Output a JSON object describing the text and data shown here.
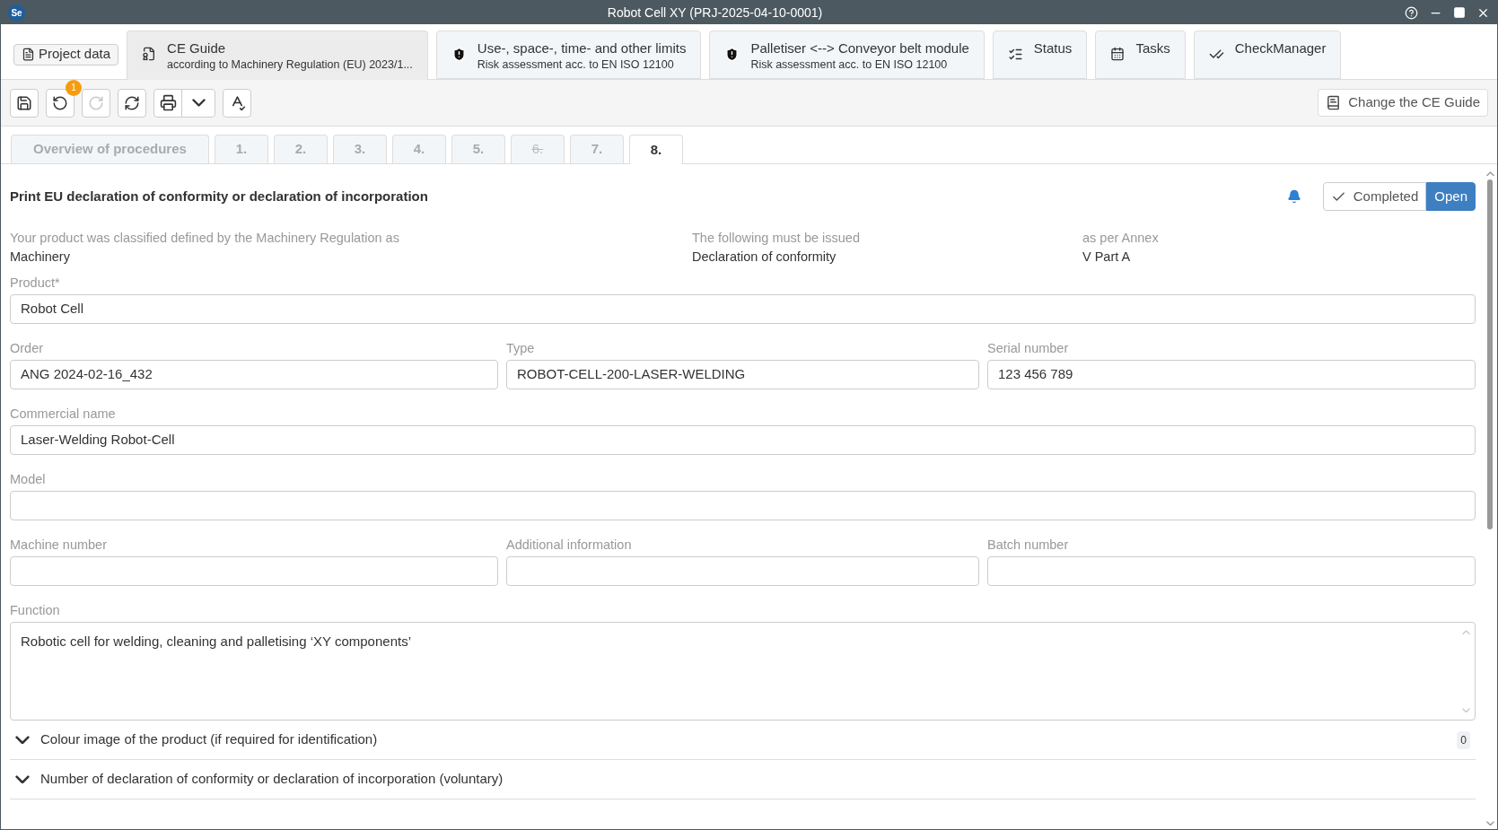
{
  "window": {
    "logo": "Se",
    "title": "Robot Cell XY (PRJ-2025-04-10-0001)"
  },
  "doc_tabs": [
    {
      "kind": "project",
      "title": "Project data"
    },
    {
      "kind": "guide",
      "title": "CE Guide",
      "subtitle": "according to Machinery Regulation (EU) 2023/1...",
      "selected": true
    },
    {
      "kind": "risk",
      "title": "Use-, space-, time- and other limits",
      "subtitle": "Risk assessment acc. to EN ISO 12100",
      "selected": false
    },
    {
      "kind": "risk",
      "title": "Palletiser <--> Conveyor belt module",
      "subtitle": "Risk assessment acc. to EN ISO 12100",
      "selected": false
    },
    {
      "kind": "status",
      "title": "Status",
      "selected": false
    },
    {
      "kind": "tasks",
      "title": "Tasks",
      "selected": false
    },
    {
      "kind": "check",
      "title": "CheckManager",
      "selected": false
    }
  ],
  "toolbar": [
    {
      "kind": "save",
      "disabled": false
    },
    {
      "kind": "undo",
      "disabled": false,
      "badge": "1"
    },
    {
      "kind": "redo",
      "disabled": true
    },
    {
      "kind": "refresh",
      "disabled": false
    },
    {
      "kind": "print",
      "disabled": false
    },
    {
      "kind": "spellcheck",
      "disabled": false
    }
  ],
  "change_guide_button": "Change the CE Guide",
  "steps": [
    {
      "label": "Overview of procedures",
      "selected": false,
      "disabled": false
    },
    {
      "label": "1.",
      "selected": false,
      "disabled": false
    },
    {
      "label": "2.",
      "selected": false,
      "disabled": false
    },
    {
      "label": "3.",
      "selected": false,
      "disabled": false
    },
    {
      "label": "4.",
      "selected": false,
      "disabled": false
    },
    {
      "label": "5.",
      "selected": false,
      "disabled": false
    },
    {
      "label": "6.",
      "selected": false,
      "disabled": true
    },
    {
      "label": "7.",
      "selected": false,
      "disabled": false
    },
    {
      "label": "8.",
      "selected": true,
      "disabled": false
    }
  ],
  "heading": "Print EU declaration of conformity or declaration of incorporation",
  "status_toggle": [
    {
      "label": "Completed",
      "selected": false
    },
    {
      "label": "Open",
      "selected": true
    }
  ],
  "info": [
    {
      "label": "Your product was classified defined by the Machinery Regulation as",
      "value": "Machinery"
    },
    {
      "label": "The following must be issued",
      "value": "Declaration of conformity"
    },
    {
      "label": "as per Annex",
      "value": "V Part A"
    }
  ],
  "field_rows": [
    [
      {
        "label": "Product*",
        "value": "Robot Cell"
      }
    ],
    [
      {
        "label": "Order",
        "value": "ANG 2024-02-16_432"
      },
      {
        "label": "Type",
        "value": "ROBOT-CELL-200-LASER-WELDING"
      },
      {
        "label": "Serial number",
        "value": "123 456 789"
      }
    ],
    [
      {
        "label": "Commercial name",
        "value": "Laser-Welding Robot-Cell"
      }
    ],
    [
      {
        "label": "Model"
      }
    ],
    [
      {
        "label": "Machine number"
      },
      {
        "label": "Additional information"
      },
      {
        "label": "Batch number"
      }
    ]
  ],
  "function": {
    "label": "Function",
    "value": "Robotic cell for welding, cleaning and palletising ‘XY components’"
  },
  "sections": [
    {
      "label": "Colour image of the product (if required for identification)",
      "expanded": false,
      "count": "0"
    },
    {
      "label": "Number of declaration of conformity or declaration of incorporation (voluntary)",
      "expanded": false
    }
  ]
}
